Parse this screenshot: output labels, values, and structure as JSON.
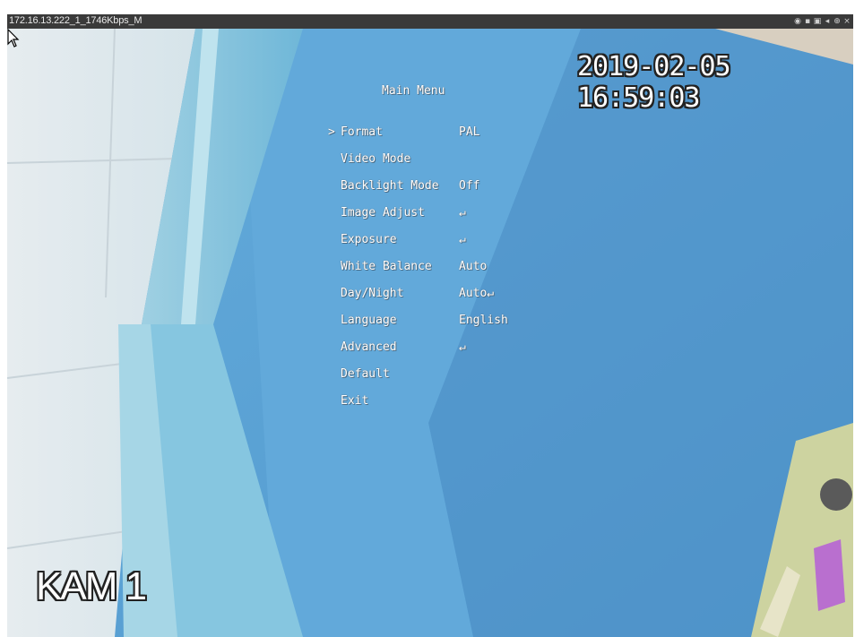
{
  "window": {
    "title": "172.16.13.222_1_1746Kbps_M",
    "icons": [
      "record-icon",
      "snapshot-icon",
      "camera-icon",
      "audio-icon",
      "zoom-icon",
      "close-icon"
    ]
  },
  "osd": {
    "timestamp": "2019-02-05 16:59:03",
    "camera_name": "KAM 1"
  },
  "menu": {
    "title": "Main Menu",
    "cursor": ">",
    "items": [
      {
        "label": "Format",
        "value": "PAL",
        "selected": true
      },
      {
        "label": "Video Mode",
        "value": ""
      },
      {
        "label": "Backlight Mode",
        "value": "Off"
      },
      {
        "label": "Image Adjust",
        "value": "↵"
      },
      {
        "label": "Exposure",
        "value": "↵"
      },
      {
        "label": "White Balance",
        "value": "Auto"
      },
      {
        "label": "Day/Night",
        "value": "Auto↵"
      },
      {
        "label": "Language",
        "value": "English"
      },
      {
        "label": "Advanced",
        "value": "↵"
      },
      {
        "label": "Default",
        "value": ""
      },
      {
        "label": "Exit",
        "value": ""
      }
    ]
  },
  "colors": {
    "wall_blue": "#5aa3d6",
    "ceiling": "#e9eef1",
    "osd_text": "#ffffff",
    "titlebar": "#3a3a3a"
  }
}
